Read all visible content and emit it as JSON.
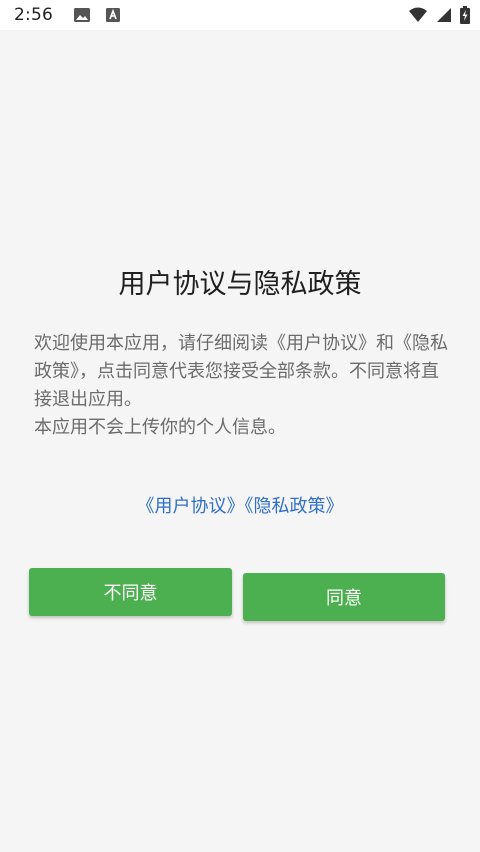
{
  "status_bar": {
    "time": "2:56",
    "icons": [
      "image-icon",
      "accessibility-icon",
      "wifi-icon",
      "signal-icon",
      "battery-charging-icon"
    ]
  },
  "dialog": {
    "title": "用户协议与隐私政策",
    "body_lines": [
      "欢迎使用本应用，请仔细阅读《用户协议》和《隐私政策》，点击同意代表您接受全部条款。不同意将直接退出应用。",
      "本应用不会上传你的个人信息。"
    ],
    "links": {
      "user_agreement": "《用户协议》",
      "privacy_policy": "《隐私政策》"
    },
    "buttons": {
      "disagree": "不同意",
      "agree": "同意"
    }
  },
  "colors": {
    "button_green": "#4caf50",
    "link_blue": "#2f6fc6",
    "background": "#f5f5f5"
  }
}
